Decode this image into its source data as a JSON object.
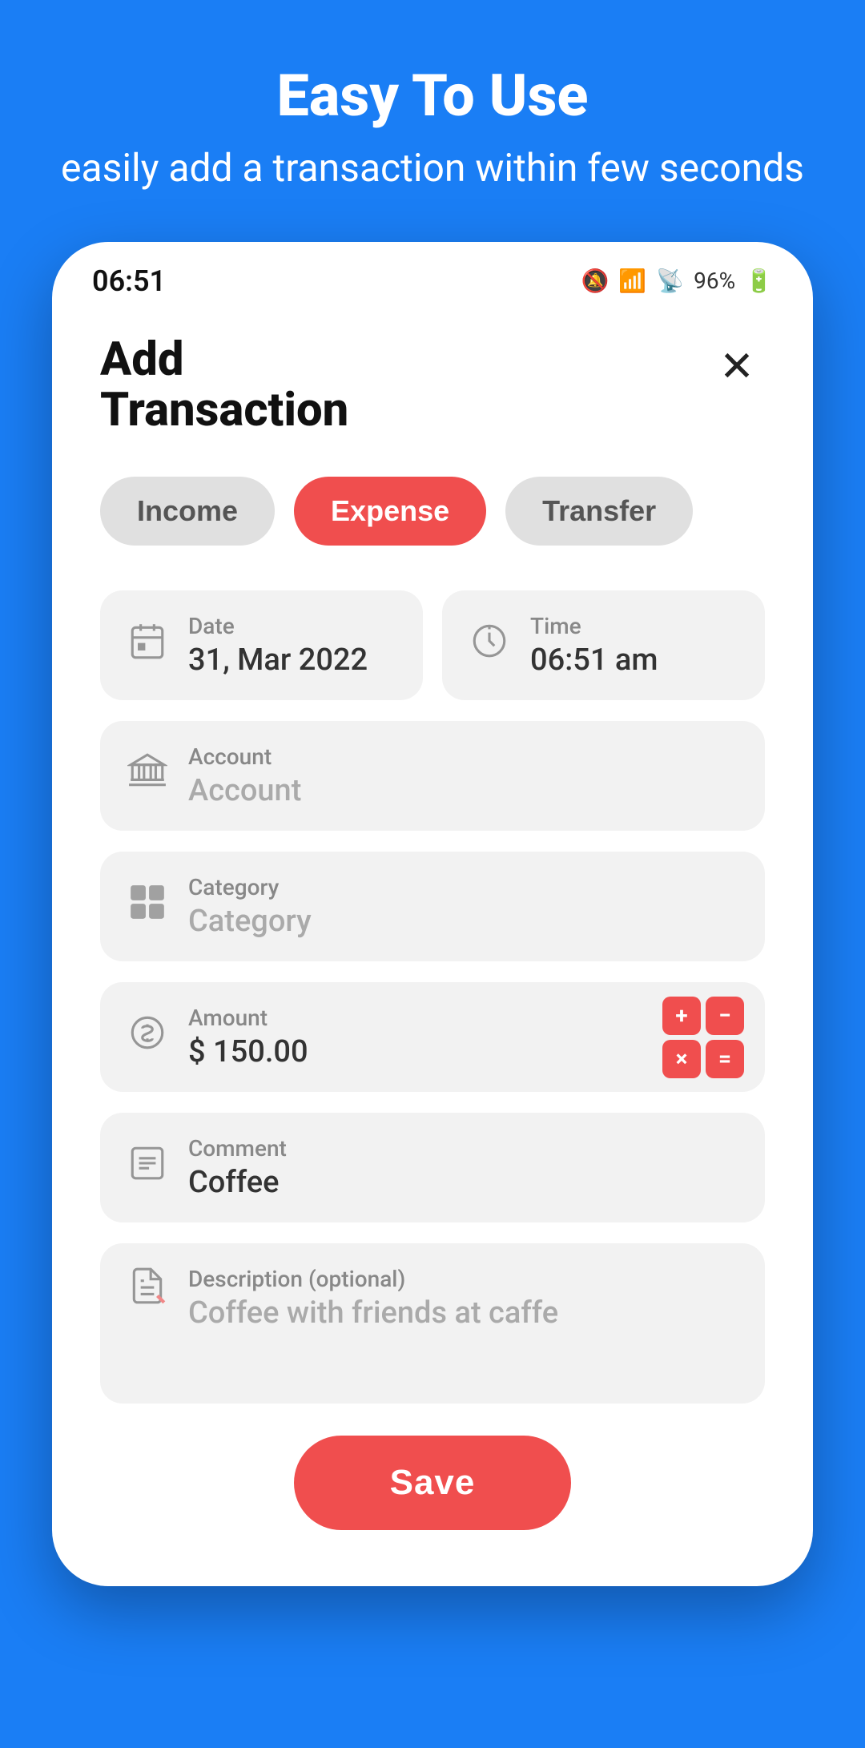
{
  "header": {
    "title": "Easy To Use",
    "subtitle": "easily add a transaction within few seconds"
  },
  "status_bar": {
    "time": "06:51",
    "battery": "96%"
  },
  "page": {
    "title_line1": "Add",
    "title_line2": "Transaction"
  },
  "tabs": [
    {
      "label": "Income",
      "active": false
    },
    {
      "label": "Expense",
      "active": true
    },
    {
      "label": "Transfer",
      "active": false
    }
  ],
  "fields": {
    "date_label": "Date",
    "date_value": "31, Mar 2022",
    "time_label": "Time",
    "time_value": "06:51 am",
    "account_label": "Account",
    "account_value": "Account",
    "category_label": "Category",
    "category_value": "Category",
    "amount_label": "Amount",
    "amount_value": "$ 150.00",
    "comment_label": "Comment",
    "comment_value": "Coffee",
    "description_label": "Description (optional)",
    "description_value": "Coffee with friends at caffe"
  },
  "save_button": "Save",
  "colors": {
    "primary": "#1a7ef5",
    "accent": "#f04e4e",
    "inactive_tab": "#e0e0e0",
    "field_bg": "#f2f2f2"
  }
}
